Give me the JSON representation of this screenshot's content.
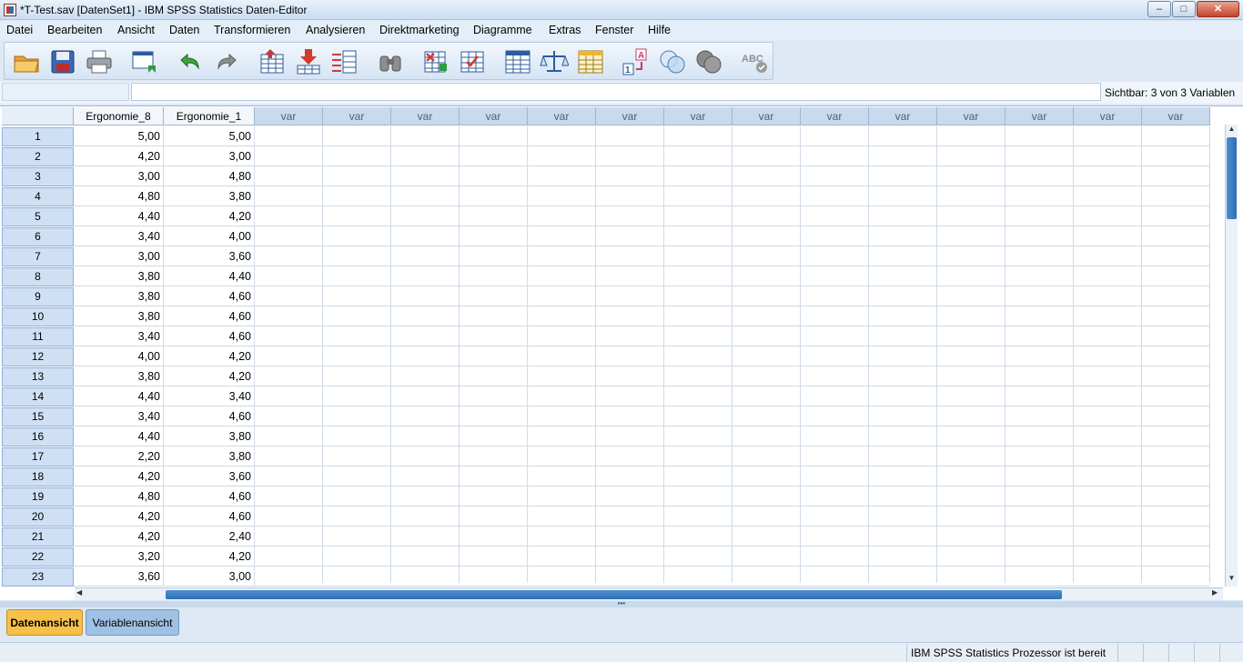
{
  "window": {
    "title": "*T-Test.sav [DatenSet1] - IBM SPSS Statistics Daten-Editor",
    "min_label": "–",
    "max_label": "□",
    "close_label": "✕"
  },
  "menu": [
    "Datei",
    "Bearbeiten",
    "Ansicht",
    "Daten",
    "Transformieren",
    "Analysieren",
    "Direktmarketing",
    "Diagramme",
    "Extras",
    "Fenster",
    "Hilfe"
  ],
  "toolbar_icons": [
    "open-folder-icon",
    "save-icon",
    "print-icon",
    "dialog-recall-icon",
    "undo-icon",
    "redo-icon",
    "goto-case-icon",
    "goto-variable-icon",
    "variables-icon",
    "find-icon",
    "insert-cases-icon",
    "insert-variable-icon",
    "split-file-icon",
    "weight-cases-icon",
    "select-cases-icon",
    "value-labels-icon",
    "use-variable-sets-icon",
    "show-all-variables-icon",
    "spell-check-icon"
  ],
  "cellbar": {
    "cell_ref": "",
    "cell_value": "",
    "visible_count": "Sichtbar: 3 von 3 Variablen"
  },
  "grid": {
    "columns": [
      "Ergonomie_8",
      "Ergonomie_1",
      "var",
      "var",
      "var",
      "var",
      "var",
      "var",
      "var",
      "var",
      "var",
      "var",
      "var",
      "var",
      "var",
      "var"
    ],
    "rows": [
      {
        "n": "1",
        "v": [
          "5,00",
          "5,00"
        ]
      },
      {
        "n": "2",
        "v": [
          "4,20",
          "3,00"
        ]
      },
      {
        "n": "3",
        "v": [
          "3,00",
          "4,80"
        ]
      },
      {
        "n": "4",
        "v": [
          "4,80",
          "3,80"
        ]
      },
      {
        "n": "5",
        "v": [
          "4,40",
          "4,20"
        ]
      },
      {
        "n": "6",
        "v": [
          "3,40",
          "4,00"
        ]
      },
      {
        "n": "7",
        "v": [
          "3,00",
          "3,60"
        ]
      },
      {
        "n": "8",
        "v": [
          "3,80",
          "4,40"
        ]
      },
      {
        "n": "9",
        "v": [
          "3,80",
          "4,60"
        ]
      },
      {
        "n": "10",
        "v": [
          "3,80",
          "4,60"
        ]
      },
      {
        "n": "11",
        "v": [
          "3,40",
          "4,60"
        ]
      },
      {
        "n": "12",
        "v": [
          "4,00",
          "4,20"
        ]
      },
      {
        "n": "13",
        "v": [
          "3,80",
          "4,20"
        ]
      },
      {
        "n": "14",
        "v": [
          "4,40",
          "3,40"
        ]
      },
      {
        "n": "15",
        "v": [
          "3,40",
          "4,60"
        ]
      },
      {
        "n": "16",
        "v": [
          "4,40",
          "3,80"
        ]
      },
      {
        "n": "17",
        "v": [
          "2,20",
          "3,80"
        ]
      },
      {
        "n": "18",
        "v": [
          "4,20",
          "3,60"
        ]
      },
      {
        "n": "19",
        "v": [
          "4,80",
          "4,60"
        ]
      },
      {
        "n": "20",
        "v": [
          "4,20",
          "4,60"
        ]
      },
      {
        "n": "21",
        "v": [
          "4,20",
          "2,40"
        ]
      },
      {
        "n": "22",
        "v": [
          "3,20",
          "4,20"
        ]
      },
      {
        "n": "23",
        "v": [
          "3,60",
          "3,00"
        ]
      }
    ]
  },
  "tabs": {
    "data_view": "Datenansicht",
    "variable_view": "Variablenansicht"
  },
  "status": {
    "text": "IBM SPSS Statistics  Prozessor ist bereit"
  }
}
